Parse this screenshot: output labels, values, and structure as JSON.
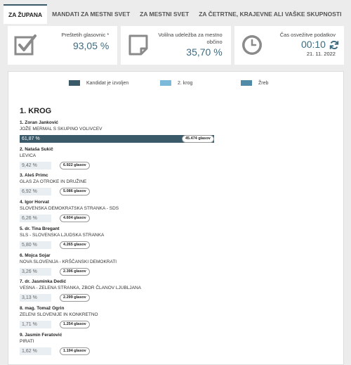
{
  "tabs": [
    {
      "label": "ZA ŽUPANA",
      "active": true
    },
    {
      "label": "MANDATI ZA MESTNI SVET",
      "active": false
    },
    {
      "label": "ZA MESTNI SVET",
      "active": false
    },
    {
      "label": "ZA ČETRTNE, KRAJEVNE ALI VAŠKE SKUPNOSTI",
      "active": false
    }
  ],
  "cards": {
    "processed": {
      "label": "Preštetih glasovnic *",
      "value": "93,05 %",
      "icon": "checkbox-icon"
    },
    "turnout": {
      "label_line1": "Volilna udeležba za mestno",
      "label_line2": "občino",
      "value": "35,70 %",
      "icon": "document-icon"
    },
    "refresh": {
      "label": "Čas osvežitve podatkov",
      "value": "00:10",
      "date": "21. 11. 2022",
      "icon": "clock-icon",
      "action_icon": "refresh-icon"
    }
  },
  "legend": [
    {
      "label": "Kandidat je izvoljen",
      "color": "#3a5a6a"
    },
    {
      "label": "2. krog",
      "color": "#7ab9d9"
    },
    {
      "label": "Žreb",
      "color": "#4f8aa6"
    }
  ],
  "round_title": "1. KROG",
  "candidates": [
    {
      "name": "1. Zoran Janković",
      "party": "JOŽE MERMAL S SKUPINO VOLIVCEV",
      "percent": "61,87 %",
      "share": 61.87,
      "votes": "45.474 glasov",
      "elected": true
    },
    {
      "name": "2. Nataša Sukič",
      "party": "LEVICA",
      "percent": "9,42 %",
      "share": 9.42,
      "votes": "6.922 glasov",
      "elected": false
    },
    {
      "name": "3. Aleš Primc",
      "party": "GLAS ZA OTROKE IN DRUŽINE",
      "percent": "6,92 %",
      "share": 6.92,
      "votes": "5.086 glasov",
      "elected": false
    },
    {
      "name": "4. Igor Horvat",
      "party": "SLOVENSKA DEMOKRATSKA STRANKA - SDS",
      "percent": "6,26 %",
      "share": 6.26,
      "votes": "4.604 glasov",
      "elected": false
    },
    {
      "name": "5. dr. Tina Bregant",
      "party": "SLS - SLOVENSKA LJUDSKA STRANKA",
      "percent": "5,80 %",
      "share": 5.8,
      "votes": "4.265 glasov",
      "elected": false
    },
    {
      "name": "6. Mojca Sojar",
      "party": "NOVA SLOVENIJA - KRŠČANSKI DEMOKRATI",
      "percent": "3,26 %",
      "share": 3.26,
      "votes": "2.396 glasov",
      "elected": false
    },
    {
      "name": "7. dr. Jasminka Dedić",
      "party": "VESNA - ZELENA STRANKA, ZBOR ČLANOV LJUBLJANA",
      "percent": "3,13 %",
      "share": 3.13,
      "votes": "2.299 glasov",
      "elected": false
    },
    {
      "name": "8. mag. Tomaž Ogrin",
      "party": "ZELENI SLOVENIJE IN KONKRETNO",
      "percent": "1,71 %",
      "share": 1.71,
      "votes": "1.254 glasov",
      "elected": false
    },
    {
      "name": "9. Jasmin Feratović",
      "party": "PIRATI",
      "percent": "1,62 %",
      "share": 1.62,
      "votes": "1.194 glasov",
      "elected": false
    }
  ]
}
